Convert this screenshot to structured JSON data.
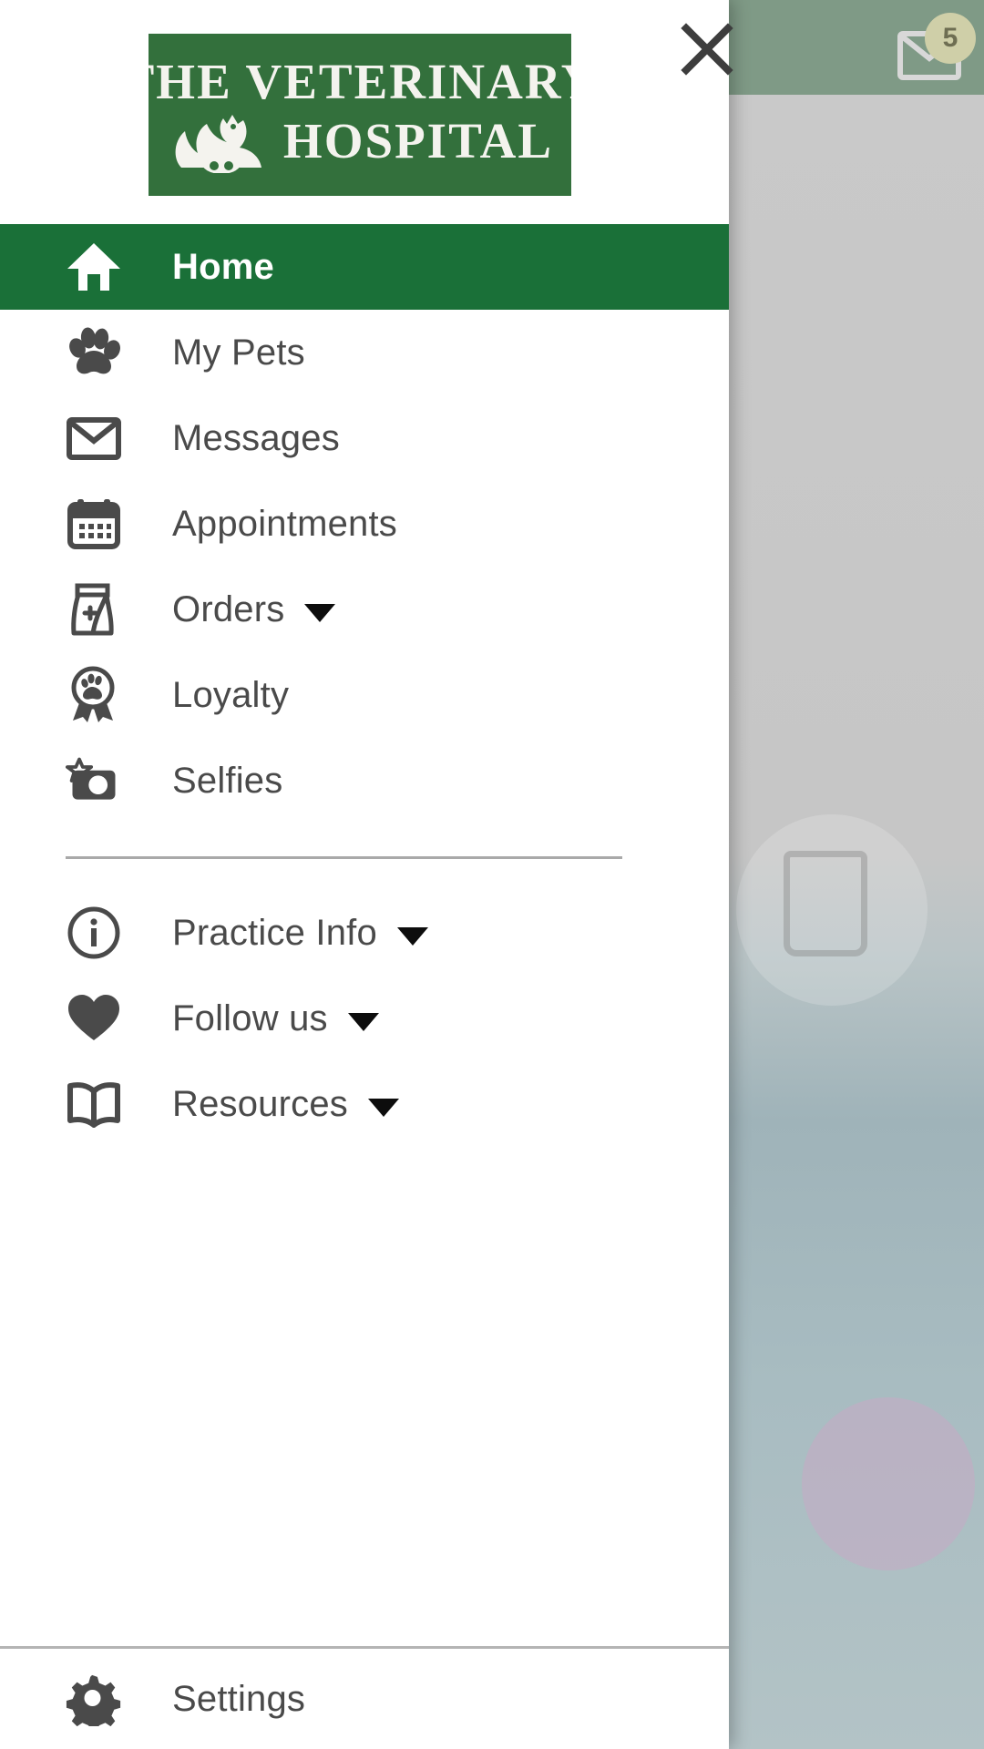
{
  "app": {
    "logo_line1": "THE VETERINARY",
    "logo_line2": "HOSPITAL",
    "logo_bg_color": "#33703c",
    "accent_green": "#1a7038",
    "icon_color": "#4a4a4a"
  },
  "close_button": {
    "name": "close",
    "glyph": "close-icon"
  },
  "background": {
    "mail_badge_count": "5",
    "mail_icon": "mail-icon"
  },
  "menu": {
    "primary": [
      {
        "label": "Home",
        "icon": "home-icon",
        "active": true,
        "has_dropdown": false
      },
      {
        "label": "My Pets",
        "icon": "paw-icon",
        "active": false,
        "has_dropdown": false
      },
      {
        "label": "Messages",
        "icon": "envelope-icon",
        "active": false,
        "has_dropdown": false
      },
      {
        "label": "Appointments",
        "icon": "calendar-icon",
        "active": false,
        "has_dropdown": false
      },
      {
        "label": "Orders",
        "icon": "food-bag-icon",
        "active": false,
        "has_dropdown": true
      },
      {
        "label": "Loyalty",
        "icon": "award-paw-icon",
        "active": false,
        "has_dropdown": false
      },
      {
        "label": "Selfies",
        "icon": "camera-star-icon",
        "active": false,
        "has_dropdown": false
      }
    ],
    "secondary": [
      {
        "label": "Practice Info",
        "icon": "info-circle-icon",
        "has_dropdown": true
      },
      {
        "label": "Follow us",
        "icon": "heart-icon",
        "has_dropdown": true
      },
      {
        "label": "Resources",
        "icon": "open-book-icon",
        "has_dropdown": true
      }
    ],
    "footer": [
      {
        "label": "Settings",
        "icon": "gear-icon",
        "has_dropdown": false
      }
    ]
  }
}
